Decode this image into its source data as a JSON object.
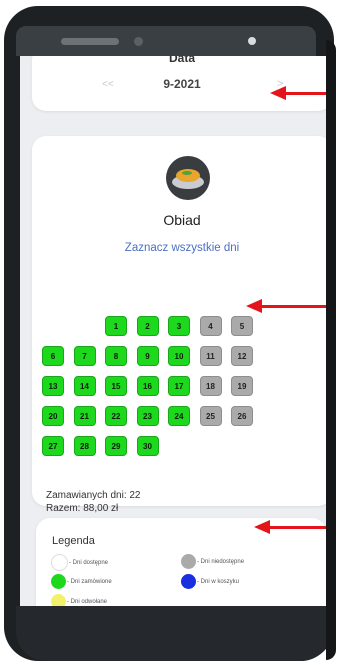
{
  "header": {
    "title": "Data",
    "prev_label": "<<",
    "month": "9-2021",
    "next_label": ">"
  },
  "meal": {
    "icon": "food-plate-icon",
    "name": "Obiad",
    "select_all": "Zaznacz wszystkie dni",
    "days": [
      {
        "day": "1",
        "status": "available"
      },
      {
        "day": "2",
        "status": "available"
      },
      {
        "day": "3",
        "status": "available"
      },
      {
        "day": "4",
        "status": "unavailable"
      },
      {
        "day": "5",
        "status": "unavailable"
      },
      {
        "day": "6",
        "status": "available"
      },
      {
        "day": "7",
        "status": "available"
      },
      {
        "day": "8",
        "status": "available"
      },
      {
        "day": "9",
        "status": "available"
      },
      {
        "day": "10",
        "status": "available"
      },
      {
        "day": "11",
        "status": "unavailable"
      },
      {
        "day": "12",
        "status": "unavailable"
      },
      {
        "day": "13",
        "status": "available"
      },
      {
        "day": "14",
        "status": "available"
      },
      {
        "day": "15",
        "status": "available"
      },
      {
        "day": "16",
        "status": "available"
      },
      {
        "day": "17",
        "status": "available"
      },
      {
        "day": "18",
        "status": "unavailable"
      },
      {
        "day": "19",
        "status": "unavailable"
      },
      {
        "day": "20",
        "status": "available"
      },
      {
        "day": "21",
        "status": "available"
      },
      {
        "day": "22",
        "status": "available"
      },
      {
        "day": "23",
        "status": "available"
      },
      {
        "day": "24",
        "status": "available"
      },
      {
        "day": "25",
        "status": "unavailable"
      },
      {
        "day": "26",
        "status": "unavailable"
      },
      {
        "day": "27",
        "status": "available"
      },
      {
        "day": "28",
        "status": "available"
      },
      {
        "day": "29",
        "status": "available"
      },
      {
        "day": "30",
        "status": "available"
      }
    ],
    "ordered_days": "Zamawianych dni: 22",
    "total": "Razem: 88,00 zł"
  },
  "legend": {
    "title": "Legenda",
    "items": [
      {
        "label": "- Dni dostępne",
        "color": "#ffffff"
      },
      {
        "label": "- Dni niedostępne",
        "color": "#aaaaaa"
      },
      {
        "label": "- Dni zamówione",
        "color": "#1ed81e"
      },
      {
        "label": "- Dni w koszyku",
        "color": "#1a2fe0"
      },
      {
        "label": "- Dni odwołane",
        "color": "#f4f06a"
      }
    ]
  },
  "colors": {
    "accent": "#4a6fc4",
    "annotation_arrow": "#e4141b"
  }
}
